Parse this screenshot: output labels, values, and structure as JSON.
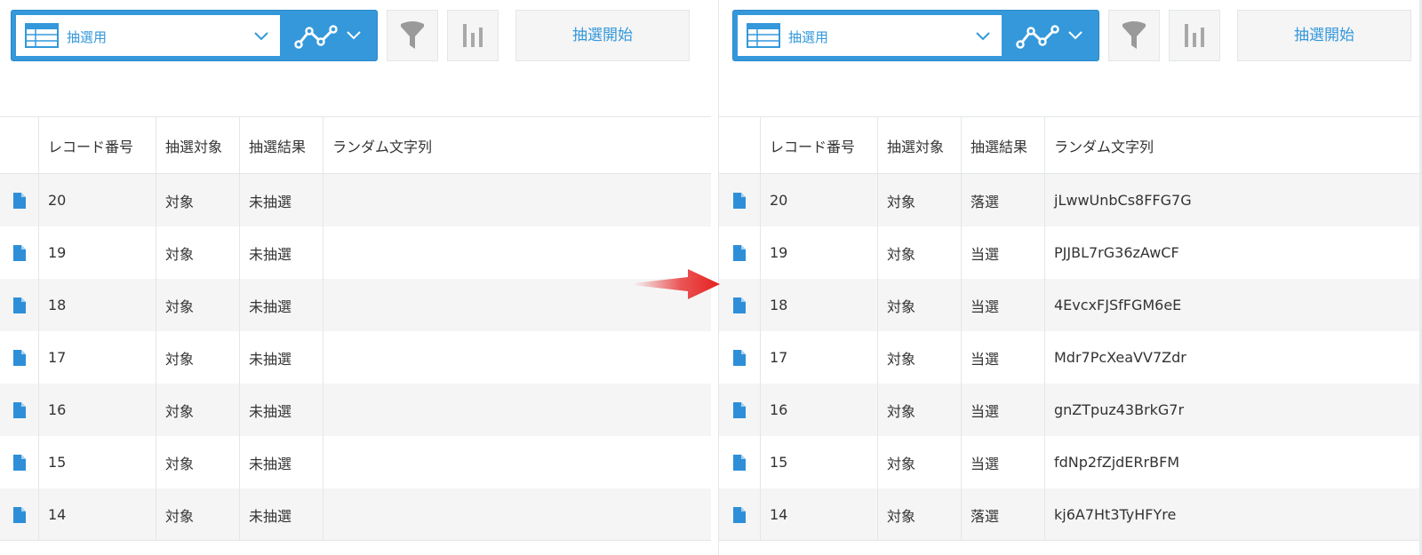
{
  "colors": {
    "accent": "#3498db",
    "arrow": "#e62020",
    "row_alt": "#f5f5f5",
    "border": "#e3e7e8"
  },
  "icons": {
    "view_icon": "table-icon",
    "select_caret": "chevron-down-icon",
    "graph_menu": "line-graph-icon",
    "filter": "filter-icon",
    "graph": "bar-chart-icon",
    "record": "document-icon",
    "transition": "arrow-right-icon"
  },
  "before": {
    "toolbar": {
      "view_name": "抽選用",
      "lottery_button": "抽選開始"
    },
    "columns": [
      "レコード番号",
      "抽選対象",
      "抽選結果",
      "ランダム文字列"
    ],
    "rows": [
      {
        "record": "20",
        "target": "対象",
        "result": "未抽選",
        "random": ""
      },
      {
        "record": "19",
        "target": "対象",
        "result": "未抽選",
        "random": ""
      },
      {
        "record": "18",
        "target": "対象",
        "result": "未抽選",
        "random": ""
      },
      {
        "record": "17",
        "target": "対象",
        "result": "未抽選",
        "random": ""
      },
      {
        "record": "16",
        "target": "対象",
        "result": "未抽選",
        "random": ""
      },
      {
        "record": "15",
        "target": "対象",
        "result": "未抽選",
        "random": ""
      },
      {
        "record": "14",
        "target": "対象",
        "result": "未抽選",
        "random": ""
      }
    ]
  },
  "after": {
    "toolbar": {
      "view_name": "抽選用",
      "lottery_button": "抽選開始"
    },
    "columns": [
      "レコード番号",
      "抽選対象",
      "抽選結果",
      "ランダム文字列"
    ],
    "rows": [
      {
        "record": "20",
        "target": "対象",
        "result": "落選",
        "random": "jLwwUnbCs8FFG7G"
      },
      {
        "record": "19",
        "target": "対象",
        "result": "当選",
        "random": "PJJBL7rG36zAwCF"
      },
      {
        "record": "18",
        "target": "対象",
        "result": "当選",
        "random": "4EvcxFJSfFGM6eE"
      },
      {
        "record": "17",
        "target": "対象",
        "result": "当選",
        "random": "Mdr7PcXeaVV7Zdr"
      },
      {
        "record": "16",
        "target": "対象",
        "result": "当選",
        "random": "gnZTpuz43BrkG7r"
      },
      {
        "record": "15",
        "target": "対象",
        "result": "当選",
        "random": "fdNp2fZjdERrBFM"
      },
      {
        "record": "14",
        "target": "対象",
        "result": "落選",
        "random": "kj6A7Ht3TyHFYre"
      }
    ]
  }
}
